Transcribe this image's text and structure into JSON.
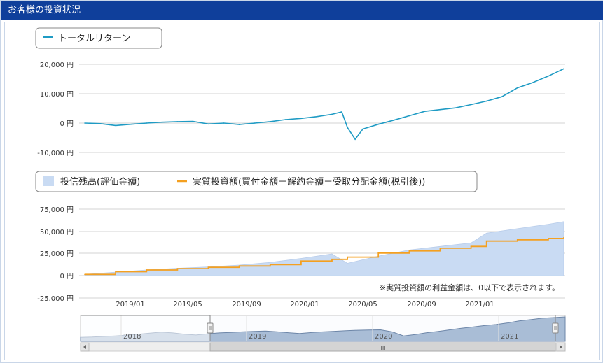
{
  "window": {
    "title": "お客様の投資状況"
  },
  "colors": {
    "header_bg": "#0f3f9b",
    "return_line": "#1f9bc4",
    "valuation_area": "#c9dbf3",
    "invested_line": "#f4a020",
    "navigator_fill": "#a9bdd6",
    "navigator_line": "#6d86a8"
  },
  "chart_data": [
    {
      "type": "line",
      "legend": [
        "トータルリターン"
      ],
      "y_ticks": [
        "20,000 円",
        "10,000 円",
        "0 円",
        "-10,000 円"
      ],
      "ylim": [
        -10000,
        20000
      ],
      "x_range": [
        "2018-10",
        "2021-05"
      ],
      "grid": true,
      "legend_position": "top-left",
      "series": [
        {
          "name": "トータルリターン",
          "x": [
            "2018-10",
            "2018-11",
            "2018-12",
            "2019-01",
            "2019-02",
            "2019-03",
            "2019-04",
            "2019-05",
            "2019-06",
            "2019-07",
            "2019-08",
            "2019-09",
            "2019-10",
            "2019-11",
            "2019-12",
            "2020-01",
            "2020-02",
            "2020-02-20",
            "2020-03-01",
            "2020-03-16",
            "2020-04",
            "2020-05",
            "2020-06",
            "2020-07",
            "2020-08",
            "2020-09",
            "2020-10",
            "2020-11",
            "2020-12",
            "2021-01",
            "2021-02",
            "2021-03",
            "2021-04",
            "2021-05"
          ],
          "values": [
            0,
            -200,
            -800,
            -400,
            0,
            300,
            500,
            600,
            -300,
            0,
            -500,
            0,
            500,
            1200,
            1600,
            2200,
            3000,
            3800,
            -1500,
            -5500,
            -2000,
            -400,
            1000,
            2500,
            4000,
            4600,
            5200,
            6300,
            7500,
            9000,
            12000,
            13800,
            16000,
            18500
          ]
        }
      ]
    },
    {
      "type": "area",
      "legend": [
        "投信残高(評価金額)",
        "実質投資額(買付金額－解約金額－受取分配金額(税引後))"
      ],
      "y_ticks": [
        "75,000 円",
        "50,000 円",
        "25,000 円",
        "0 円",
        "-25,000 円"
      ],
      "ylim": [
        -25000,
        75000
      ],
      "x_ticks": [
        "2019/01",
        "2019/05",
        "2019/09",
        "2020/01",
        "2020/05",
        "2020/09",
        "2021/01"
      ],
      "x_range": [
        "2018-10",
        "2021-05"
      ],
      "grid": true,
      "legend_position": "top-left",
      "note": "※実質投資額の利益金額は、0以下で表示されます。",
      "series": [
        {
          "name": "投信残高(評価金額)",
          "x": [
            "2018-10",
            "2018-12",
            "2019-02",
            "2019-04",
            "2019-06",
            "2019-08",
            "2019-10",
            "2019-12",
            "2020-02",
            "2020-03",
            "2020-05",
            "2020-07",
            "2020-09",
            "2020-11",
            "2020-12",
            "2021-02",
            "2021-04",
            "2021-05"
          ],
          "values": [
            1500,
            4000,
            6500,
            8500,
            10000,
            12000,
            15000,
            19500,
            24500,
            14000,
            22000,
            29000,
            33000,
            37000,
            48000,
            53000,
            58000,
            61000
          ]
        },
        {
          "name": "実質投資額(買付金額－解約金額－受取分配金額(税引後))",
          "x": [
            "2018-10",
            "2018-12",
            "2019-02",
            "2019-04",
            "2019-06",
            "2019-08",
            "2019-10",
            "2019-12",
            "2020-02",
            "2020-03",
            "2020-05",
            "2020-07",
            "2020-09",
            "2020-11",
            "2020-12",
            "2021-02",
            "2021-04",
            "2021-05"
          ],
          "values": [
            1500,
            4500,
            6500,
            8000,
            9500,
            11000,
            12500,
            16500,
            18500,
            21000,
            25500,
            28000,
            31000,
            33000,
            39000,
            40500,
            42000,
            43000
          ]
        }
      ]
    },
    {
      "type": "area",
      "role": "navigator",
      "x_ticks": [
        "2018",
        "2019",
        "2020",
        "2021"
      ],
      "scrollbar_label": "III",
      "values": [
        3,
        3.2,
        3.6,
        4,
        4.6,
        5.3,
        6,
        6.8,
        6.2,
        5.3,
        4.7,
        5.5,
        6.2,
        6.6,
        7,
        7.3,
        7.6,
        7.1,
        6.4,
        5.8,
        6.5,
        7,
        7.4,
        7.8,
        8.2,
        8.4,
        8.5,
        7,
        4,
        5,
        6.4,
        7.3,
        8.5,
        9.6,
        10.6,
        11.6,
        12.4,
        13.6,
        15,
        16,
        17,
        17.5,
        18
      ]
    }
  ]
}
